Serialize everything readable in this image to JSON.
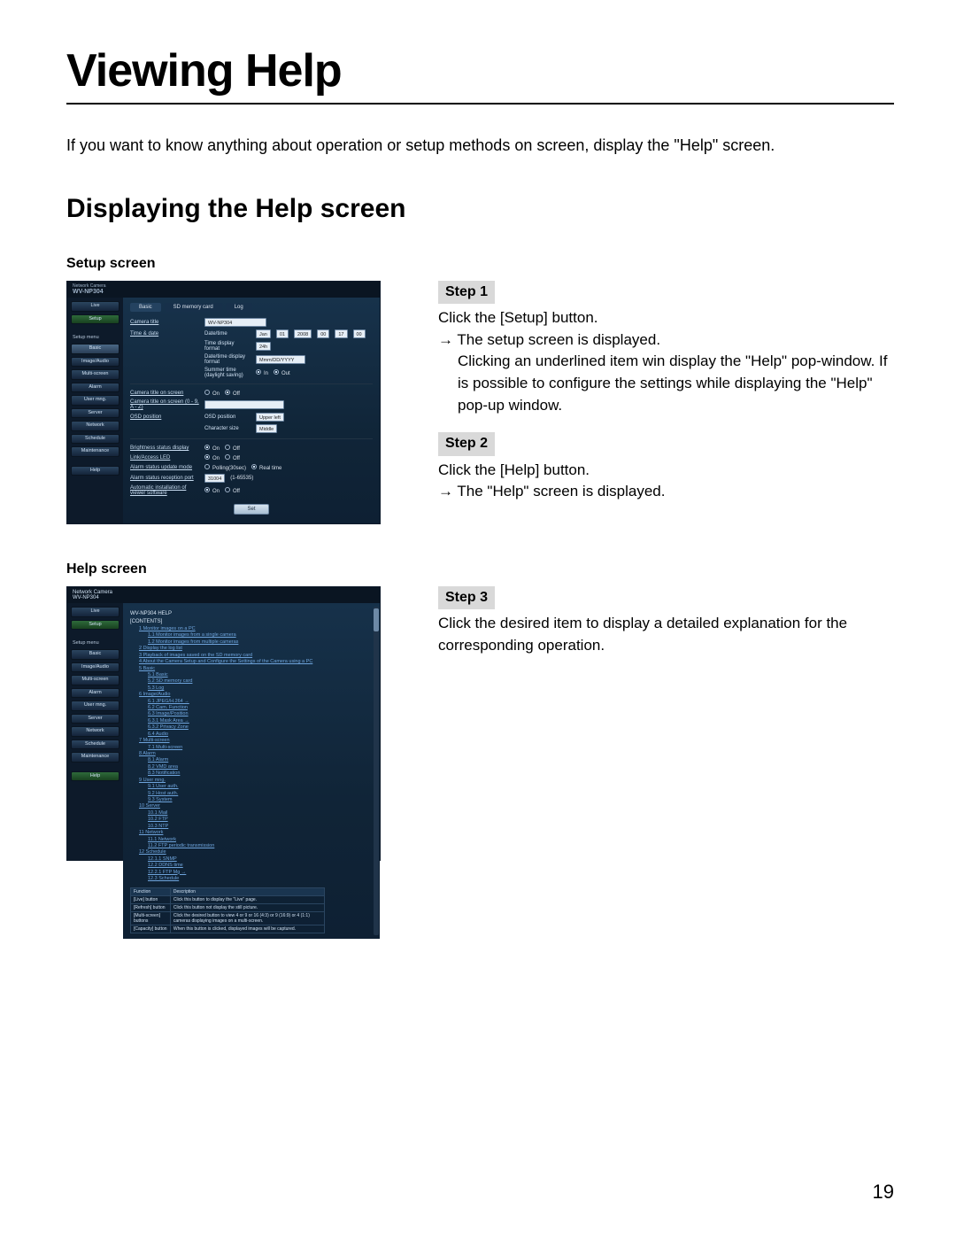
{
  "title": "Viewing Help",
  "intro": "If you want to know anything about operation or setup methods on screen, display the \"Help\" screen.",
  "subtitle": "Displaying the Help screen",
  "labels": {
    "setup_screen": "Setup screen",
    "help_screen": "Help screen"
  },
  "steps": {
    "s1_badge": "Step 1",
    "s1_l1": "Click the [Setup] button.",
    "s1_l2": "→ The setup screen is displayed.",
    "s1_l3": "Clicking an underlined item win display the \"Help\" pop-window. If is possible to configure the settings while displaying the \"Help\" pop-up window.",
    "s2_badge": "Step 2",
    "s2_l1": "Click the [Help] button.",
    "s2_l2": "→ The \"Help\" screen is displayed.",
    "s3_badge": "Step 3",
    "s3_l1": "Click the desired item to display a detailed explanation for the corresponding operation."
  },
  "shot_setup": {
    "brand": "Network Camera",
    "model": "WV-NP304",
    "top_buttons": {
      "live": "Live",
      "setup": "Setup"
    },
    "side_heading": "Setup menu",
    "side_items": [
      "Basic",
      "Image/Audio",
      "Multi-screen",
      "Alarm",
      "User mng.",
      "Server",
      "Network",
      "Schedule",
      "Maintenance",
      "Help"
    ],
    "tabs": [
      "Basic",
      "SD memory card",
      "Log"
    ],
    "rows": {
      "camera_title_lbl": "Camera title",
      "camera_title_val": "WV-NP304",
      "time_date_lbl": "Time & date",
      "date_time_lbl": "Date/time",
      "date_time_val": [
        "Jan",
        "01",
        "2008",
        "00",
        "17",
        "00"
      ],
      "time_display_lbl": "Time display format",
      "time_display_val": "24h",
      "date_format_lbl": "Date/time display format",
      "date_format_val": "Mmm/DD/YYYY",
      "summer_lbl": "Summer time (daylight saving)",
      "summer_opts": [
        "In",
        "Out"
      ],
      "cam_onscreen_lbl": "Camera title on screen",
      "cam_onscreen_opts": [
        "On",
        "Off"
      ],
      "cam_onscreen2_lbl": "Camera title on screen (0 - 9, A - Z)",
      "osd_pos_lbl": "OSD position",
      "osd_pos_sub": "OSD position",
      "osd_pos_val": "Upper left",
      "char_size_lbl": "Character size",
      "char_size_val": "Middle",
      "bright_lbl": "Brightness status display",
      "bright_opts": [
        "On",
        "Off"
      ],
      "link_led_lbl": "Link/Access LED",
      "link_led_opts": [
        "On",
        "Off"
      ],
      "alarm_mode_lbl": "Alarm status update mode",
      "alarm_mode_opts": [
        "Polling(30sec)",
        "Real time"
      ],
      "alarm_port_lbl": "Alarm status reception port",
      "alarm_port_val": "31004",
      "alarm_port_range": "(1-65535)",
      "auto_install_lbl": "Automatic installation of viewer software",
      "auto_install_opts": [
        "On",
        "Off"
      ],
      "set_button": "Set"
    }
  },
  "shot_help": {
    "heading": "WV-NP304 HELP",
    "contents_h": "[CONTENTS]",
    "toc": [
      "1 Monitor images on a PC",
      "1.1 Monitor images from a single camera",
      "1.2 Monitor images from multiple cameras",
      "2 Display the log list",
      "3 Playback of images saved on the SD memory card",
      "4 About the Camera Setup and Configure the Settings of the Camera using a PC",
      "5 Basic",
      "5.1 Basic",
      "5.2 SD memory card",
      "5.3 Log",
      "6 Image/Audio",
      "6.1 JPEG/H.264 →",
      "6.2 Cam. Function",
      "6.3 Image/Position",
      "6.3.1 Mask Area →",
      "6.3.2 Privacy Zone",
      "6.4 Audio",
      "7 Multi-screen",
      "7.1 Multi-screen",
      "8 Alarm",
      "8.1 Alarm",
      "8.2 VMD area",
      "8.3 Notification",
      "9 User mng.",
      "9.1 User auth.",
      "9.2 Host auth.",
      "9.3 System",
      "10 Server",
      "10.1 Mail",
      "10.2 FTP",
      "10.3 NTP",
      "11 Network",
      "11.1 Network",
      "11.2 FTP periodic transmission",
      "12 Schedule",
      "12.1.1 SNMP",
      "12.2 DDNS time",
      "12.2.1 FTP Mg →",
      "12.3 Schedule"
    ],
    "table_h": [
      "Function",
      "Description"
    ],
    "table_rows": [
      [
        "[Live] button",
        "Click this button to display the \"Live\" page."
      ],
      [
        "[Refresh] button",
        "Click this button not display the still picture."
      ],
      [
        "[Multi-screen] buttons",
        "Click the desired button to view 4 or 9 or 16 (4:3) or 9 (16:9) or 4 (1:1) cameras displaying images on a multi-screen."
      ],
      [
        "[Capacity] button",
        "When this button is clicked, displayed images will be captured."
      ]
    ]
  },
  "page_number": "19"
}
